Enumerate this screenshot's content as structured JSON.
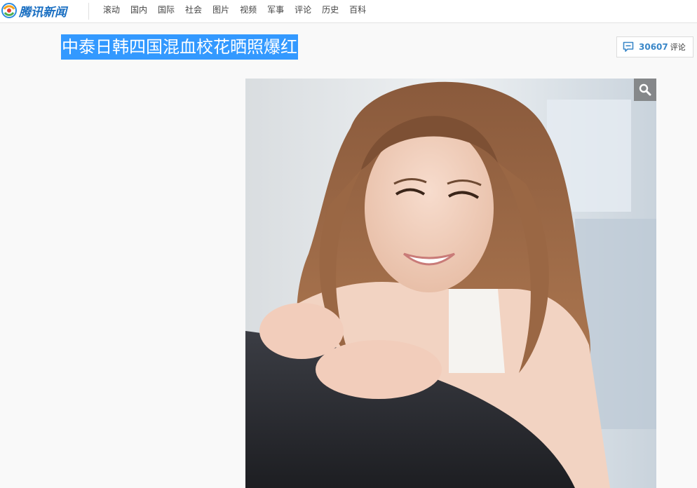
{
  "site": {
    "logo_text": "腾讯新闻",
    "logo_icon": "tencent-news-logo-icon",
    "nav": [
      {
        "label": "滚动"
      },
      {
        "label": "国内"
      },
      {
        "label": "国际"
      },
      {
        "label": "社会"
      },
      {
        "label": "图片"
      },
      {
        "label": "视频"
      },
      {
        "label": "军事"
      },
      {
        "label": "评论"
      },
      {
        "label": "历史"
      },
      {
        "label": "百科"
      }
    ]
  },
  "article": {
    "title": "中泰日韩四国混血校花晒照爆红",
    "title_selected": true
  },
  "comments": {
    "count": "30607",
    "label": "评论",
    "icon": "comment-bubble-icon"
  },
  "gallery": {
    "zoom_icon": "magnifier-icon",
    "photo_subject": "photo"
  },
  "colors": {
    "selection": "#3399ff",
    "brand_blue": "#1a6fc2",
    "comment_count": "#3a87c8",
    "page_bg": "#f9f9f9"
  }
}
